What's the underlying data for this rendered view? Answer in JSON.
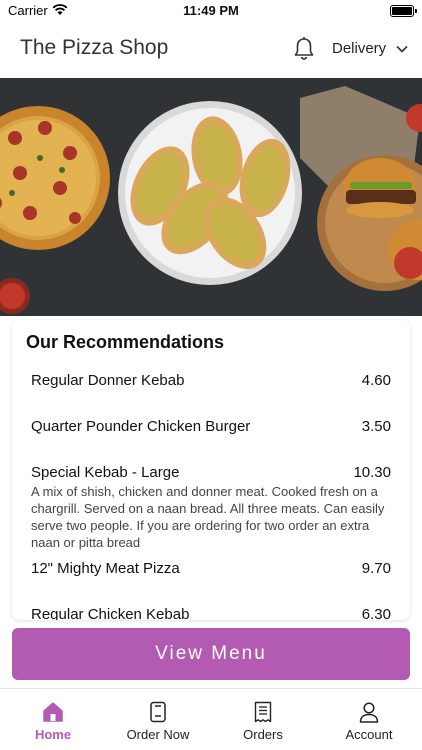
{
  "status_bar": {
    "carrier": "Carrier",
    "time": "11:49 PM",
    "battery_level": 1.0
  },
  "header": {
    "title": "The Pizza Shop",
    "delivery_label": "Delivery"
  },
  "icons": [
    "wifi-icon",
    "bell-icon",
    "chevron-down-icon",
    "home-icon",
    "order-now-icon",
    "orders-receipt-icon",
    "account-icon"
  ],
  "recommendations": {
    "title": "Our Recommendations",
    "items": [
      {
        "name": "Regular Donner Kebab",
        "price": "4.60",
        "description": ""
      },
      {
        "name": "Quarter Pounder Chicken Burger",
        "price": "3.50",
        "description": ""
      },
      {
        "name": "Special Kebab - Large",
        "price": "10.30",
        "description": "A mix of shish, chicken and donner meat. Cooked fresh on a chargrill. Served on a naan bread. All three meats. Can easily serve two people. If you are ordering for two order an extra naan or pitta bread"
      },
      {
        "name": "12\" Mighty Meat Pizza",
        "price": "9.70",
        "description": ""
      },
      {
        "name": "Regular Chicken Kebab",
        "price": "6.30",
        "description": ""
      }
    ]
  },
  "view_menu_label": "View Menu",
  "tabs": [
    {
      "label": "Home",
      "active": true
    },
    {
      "label": "Order Now",
      "active": false
    },
    {
      "label": "Orders",
      "active": false
    },
    {
      "label": "Account",
      "active": false
    }
  ],
  "colors": {
    "accent": "#b35bb2",
    "hero_background": "#2a2c2e"
  }
}
